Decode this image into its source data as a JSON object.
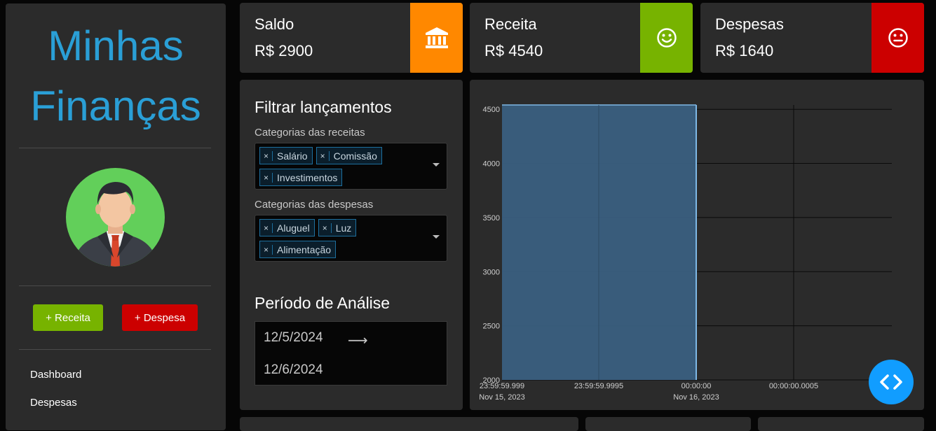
{
  "sidebar": {
    "title_line1": "Minhas",
    "title_line2": "Finanças",
    "btn_receita": "+ Receita",
    "btn_despesa": "+ Despesa",
    "nav": [
      "Dashboard",
      "Despesas"
    ]
  },
  "cards": {
    "saldo": {
      "title": "Saldo",
      "value": "R$ 2900",
      "color": "#ff8800",
      "icon": "bank-icon"
    },
    "receita": {
      "title": "Receita",
      "value": "R$ 4540",
      "color": "#77b300",
      "icon": "smile-icon"
    },
    "despesas": {
      "title": "Despesas",
      "value": "R$ 1640",
      "color": "#cc0000",
      "icon": "neutral-face-icon"
    }
  },
  "filter": {
    "title": "Filtrar lançamentos",
    "receitas_label": "Categorias das receitas",
    "receitas_tags": [
      "Salário",
      "Comissão",
      "Investimentos"
    ],
    "despesas_label": "Categorias das despesas",
    "despesas_tags": [
      "Aluguel",
      "Luz",
      "Alimentação"
    ],
    "period_title": "Período de Análise",
    "start_date": "12/5/2024",
    "end_date": "12/6/2024"
  },
  "chart_data": {
    "type": "area",
    "y_ticks": [
      "4500",
      "4000",
      "3500",
      "3000",
      "2500",
      "2000"
    ],
    "ylim": [
      2000,
      4540
    ],
    "x_ticks": [
      {
        "line1": "23:59:59.999",
        "line2": "Nov 15, 2023"
      },
      {
        "line1": "23:59:59.9995",
        "line2": ""
      },
      {
        "line1": "00:00:00",
        "line2": "Nov 16, 2023"
      },
      {
        "line1": "00:00:00.0005",
        "line2": ""
      }
    ],
    "series": [
      {
        "values": [
          4540,
          4540,
          4540
        ]
      }
    ],
    "fill_color": "#3a5f80",
    "line_color": "#7fb8e6",
    "grid": true
  },
  "colors": {
    "accent": "#2a9fd6",
    "fab": "#119dff"
  }
}
